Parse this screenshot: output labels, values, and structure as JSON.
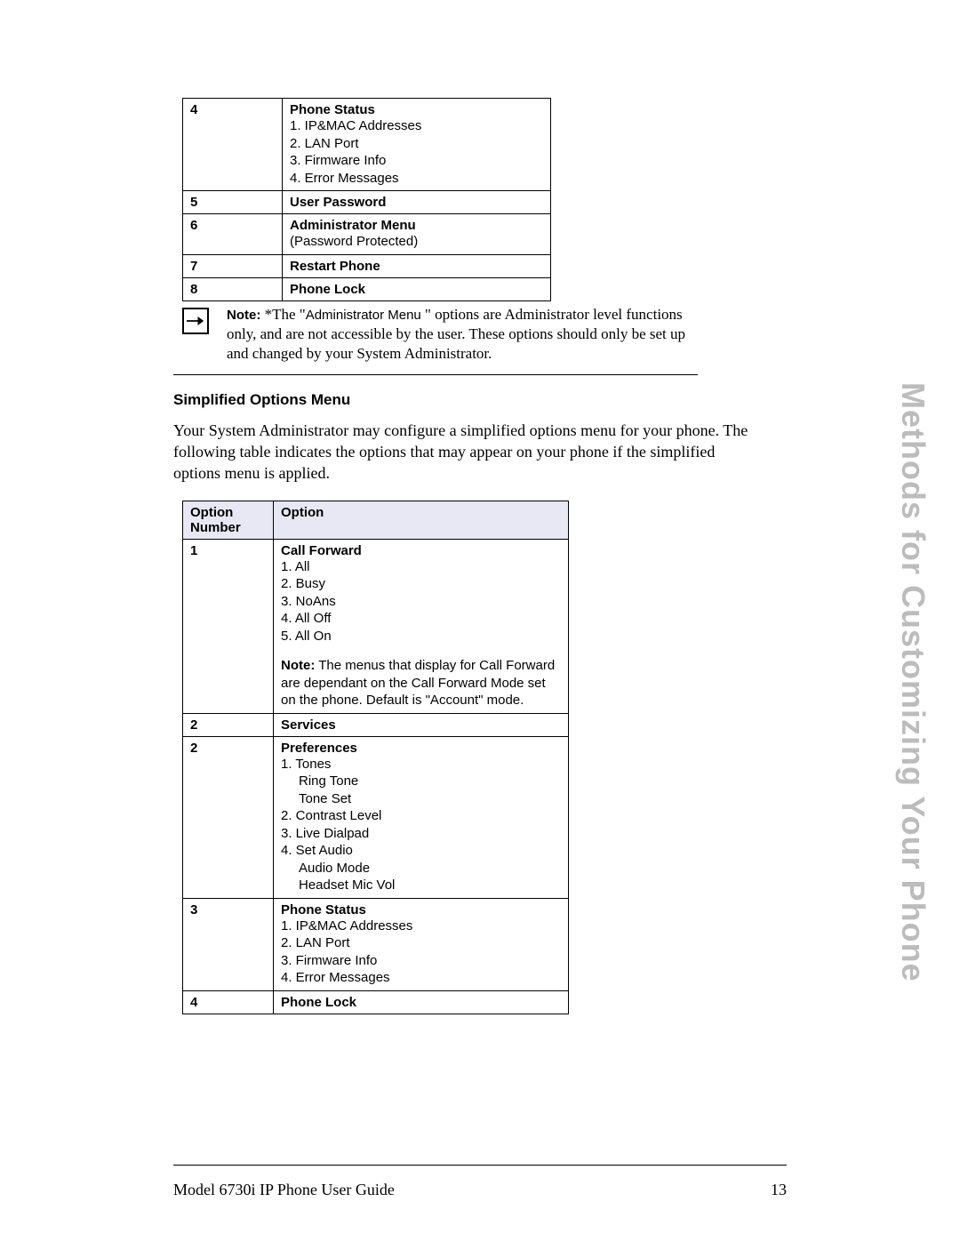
{
  "top_table": {
    "rows": [
      {
        "num": "4",
        "title": "Phone Status",
        "items": [
          "1. IP&MAC Addresses",
          "2. LAN Port",
          "3. Firmware Info",
          "4. Error Messages"
        ]
      },
      {
        "num": "5",
        "title": "User Password",
        "items": []
      },
      {
        "num": "6",
        "title": "Administrator Menu",
        "items": [
          "(Password Protected)"
        ]
      },
      {
        "num": "7",
        "title": "Restart Phone",
        "items": []
      },
      {
        "num": "8",
        "title": "Phone Lock",
        "items": []
      }
    ]
  },
  "note": {
    "label": "Note:",
    "pre": " *The \"",
    "admin_text": "Administrator Menu ",
    "post": "\" options are Administrator level functions only, and are not accessible by the user. These options should only be set up and changed by your System Administrator."
  },
  "section_heading": "Simplified Options Menu",
  "body_para": "Your System Administrator may configure a simplified options menu for your phone. The following table indicates the options that may appear on your phone if the simplified options menu is applied.",
  "opt_table": {
    "head1": "Option Number",
    "head2": "Option",
    "rows": [
      {
        "num": "1",
        "title": "Call Forward",
        "items": [
          "1. All",
          "2. Busy",
          "3. NoAns",
          "4. All Off",
          "5. All On"
        ],
        "note_label": "Note:",
        "note_text": " The menus that display for Call Forward are dependant on the Call Forward Mode set on the phone. Default is \"Account\" mode."
      },
      {
        "num": "2",
        "title": "Services"
      },
      {
        "num": "2",
        "title": "Preferences",
        "items": [
          "1. Tones"
        ],
        "sub_items_a": [
          "Ring Tone",
          "Tone Set"
        ],
        "items2": [
          "2. Contrast Level",
          "3. Live Dialpad",
          "4. Set Audio"
        ],
        "sub_items_b": [
          "Audio Mode",
          "Headset Mic Vol"
        ]
      },
      {
        "num": "3",
        "title": "Phone Status",
        "items": [
          "1. IP&MAC Addresses",
          "2. LAN Port",
          "3. Firmware Info",
          "4. Error Messages"
        ]
      },
      {
        "num": "4",
        "title": "Phone Lock"
      }
    ]
  },
  "footer_left": "Model 6730i IP Phone User Guide",
  "footer_right": "13",
  "side_tab": "Methods for Customizing Your Phone"
}
